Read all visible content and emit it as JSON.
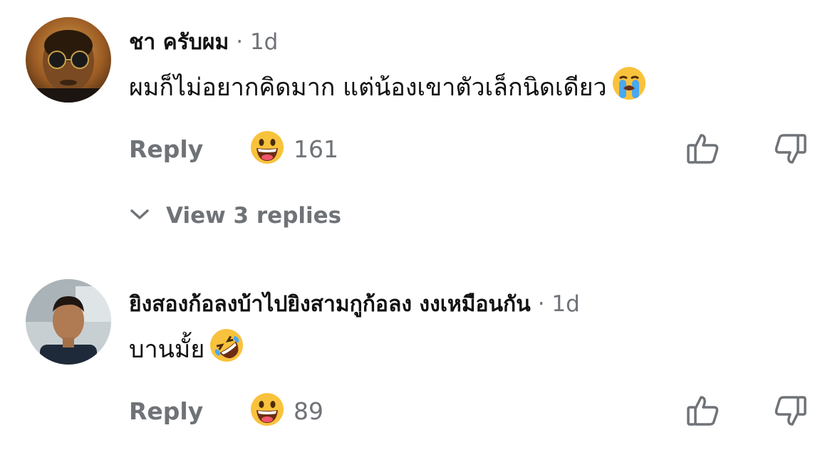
{
  "comments": [
    {
      "author": "ชา ครับผม",
      "meta": "· 1d",
      "text": "ผมก็ไม่อยากคิดมาก แต่น้องเขาตัวเล็กนิดเดียว",
      "text_emoji": "loudly-crying-face",
      "reply_label": "Reply",
      "reaction_emoji": "grinning-face",
      "reaction_count": "161",
      "view_replies": "View 3 replies"
    },
    {
      "author": "ยิงสองก้อลงบ้าไปยิงสามกูก้อลง งงเหมือนกัน",
      "meta": "· 1d",
      "text": "บานมั้ย",
      "text_emoji": "rolling-on-floor-laughing",
      "reply_label": "Reply",
      "reaction_emoji": "grinning-face",
      "reaction_count": "89"
    }
  ],
  "colors": {
    "muted": "#6f7378",
    "text": "#111111",
    "emoji_yellow": "#f9c23c"
  }
}
